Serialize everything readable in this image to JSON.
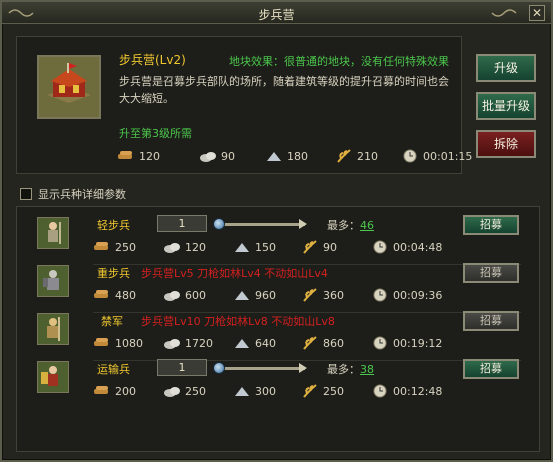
{
  "window": {
    "title": "步兵营",
    "close_label": "✕"
  },
  "building": {
    "name": "步兵营(Lv2)",
    "effect": "地块效果：很普通的地块，没有任何特殊效果",
    "description": "步兵营是召募步兵部队的场所，随着建筑等级的提升召募的时间也会大大缩短。",
    "upgrade_need_label": "升至第3级所需",
    "costs": {
      "wood": "120",
      "stone": "90",
      "iron": "180",
      "food": "210",
      "time": "00:01:15"
    }
  },
  "side_buttons": {
    "upgrade": "升级",
    "batch_upgrade": "批量升级",
    "demolish": "拆除"
  },
  "show_details_label": "显示兵种详细参数",
  "units": [
    {
      "name": "轻步兵",
      "available": true,
      "qty": "1",
      "max_label": "最多：",
      "max": "46",
      "recruit": "招募",
      "costs": {
        "wood": "250",
        "stone": "120",
        "iron": "150",
        "food": "90",
        "time": "00:04:48"
      }
    },
    {
      "name": "重步兵",
      "available": false,
      "requirement": "步兵营Lv5 刀枪如林Lv4 不动如山Lv4",
      "recruit": "招募",
      "costs": {
        "wood": "480",
        "stone": "600",
        "iron": "960",
        "food": "360",
        "time": "00:09:36"
      }
    },
    {
      "name": "禁军",
      "available": false,
      "requirement": "步兵营Lv10 刀枪如林Lv8 不动如山Lv8",
      "recruit": "招募",
      "costs": {
        "wood": "1080",
        "stone": "1720",
        "iron": "640",
        "food": "860",
        "time": "00:19:12"
      }
    },
    {
      "name": "运输兵",
      "available": true,
      "qty": "1",
      "max_label": "最多：",
      "max": "38",
      "recruit": "招募",
      "costs": {
        "wood": "200",
        "stone": "250",
        "iron": "300",
        "food": "250",
        "time": "00:12:48"
      }
    }
  ],
  "colors": {
    "accent_gold": "#f0c830",
    "accent_green": "#4cc64c",
    "warning_red": "#d42020"
  }
}
